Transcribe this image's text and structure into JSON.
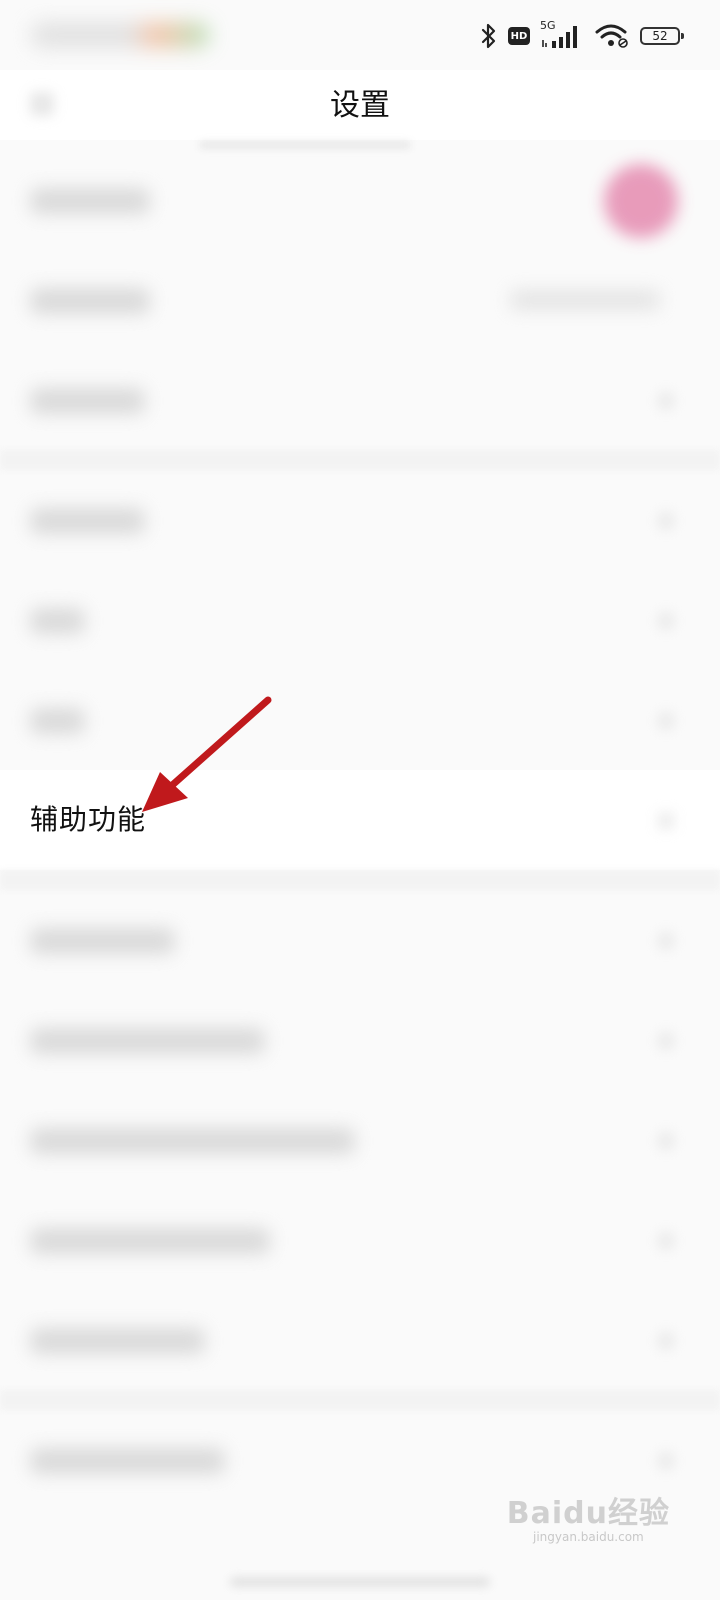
{
  "status_bar": {
    "network": "5G",
    "hd": "HD",
    "battery": "52",
    "icons": [
      "bluetooth-icon",
      "hd-icon",
      "signal-icon",
      "wifi-icon",
      "battery-icon"
    ]
  },
  "header": {
    "title": "设置"
  },
  "list": {
    "highlighted_item": "辅助功能"
  },
  "colors": {
    "arrow": "#c0191c",
    "avatar": "#e58bb0"
  },
  "watermark": {
    "brand": "Baidu经验",
    "url": "jingyan.baidu.com"
  }
}
